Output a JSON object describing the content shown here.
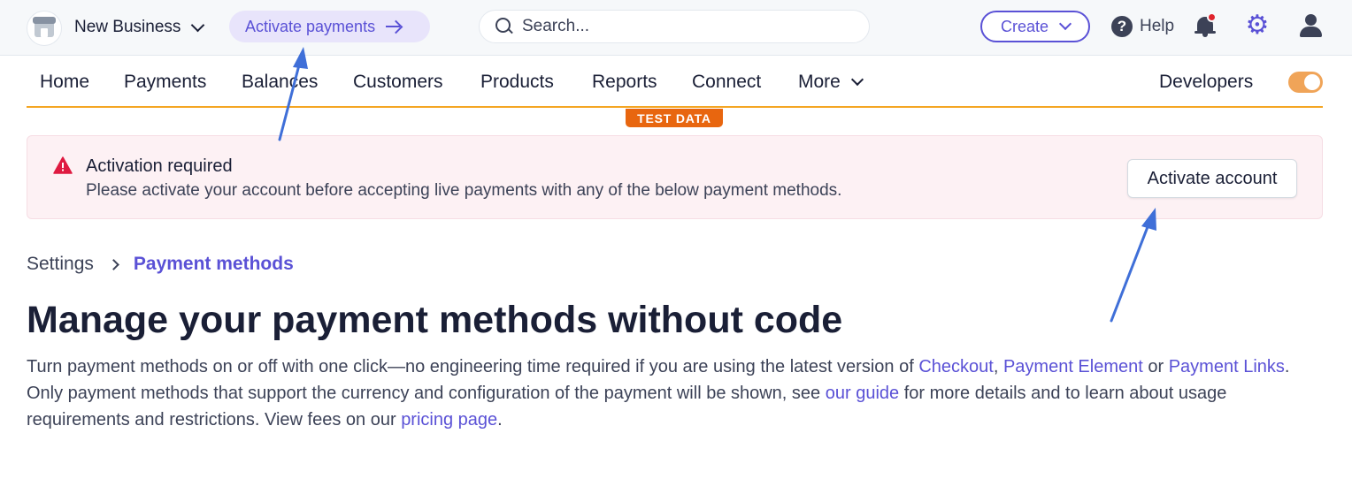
{
  "topbar": {
    "business_name": "New Business",
    "activate_payments_label": "Activate payments",
    "search_placeholder": "Search...",
    "create_label": "Create",
    "help_label": "Help",
    "icons": [
      "store-icon",
      "chevron-down-icon",
      "arrow-right-icon",
      "search-icon",
      "help-icon",
      "bell-icon",
      "gear-icon",
      "user-icon"
    ],
    "notification_dot_color": "#e0242d"
  },
  "nav": {
    "items": [
      "Home",
      "Payments",
      "Balances",
      "Customers",
      "Products",
      "Reports",
      "Connect",
      "More"
    ],
    "developers_label": "Developers",
    "test_mode_on": true,
    "accent_color": "#f4a623"
  },
  "test_badge": "TEST DATA",
  "banner": {
    "title": "Activation required",
    "text": "Please activate your account before accepting live payments with any of the below payment methods.",
    "button_label": "Activate account"
  },
  "breadcrumb": {
    "parent": "Settings",
    "current": "Payment methods"
  },
  "page": {
    "title": "Manage your payment methods without code",
    "desc": {
      "t1": "Turn payment methods on or off with one click—no engineering time required if you are using the latest version of ",
      "l1": "Checkout",
      "t2": ", ",
      "l2": "Payment Element",
      "t3": " or ",
      "l3": "Payment Links",
      "t4": ". Only payment methods that support the currency and configuration of the payment will be shown, see ",
      "l4": "our guide",
      "t5": " for more details and to learn about usage requirements and restrictions. View fees on our ",
      "l5": "pricing page",
      "t6": "."
    }
  },
  "colors": {
    "brand": "#5a51d6",
    "annotation_arrow": "#3f6fd8",
    "banner_bg": "#fdf1f4",
    "warning": "#df1b41"
  }
}
